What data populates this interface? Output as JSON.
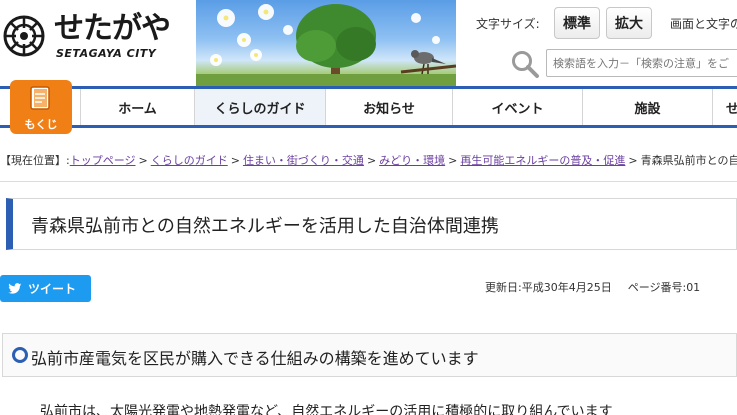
{
  "header": {
    "logo_jp": "せたがや",
    "logo_en": "SETAGAYA CITY",
    "font_size_label": "文字サイズ:",
    "font_size_standard": "標準",
    "font_size_large": "拡大",
    "color_label": "画面と文字の",
    "search_placeholder": "検索語を入力－「検索の注意」をご"
  },
  "nav": {
    "mokuji_label": "もくじ",
    "items": [
      {
        "label": "ホーム"
      },
      {
        "label": "くらしのガイド",
        "active": true
      },
      {
        "label": "お知らせ"
      },
      {
        "label": "イベント"
      },
      {
        "label": "施設"
      },
      {
        "label": "せ"
      }
    ]
  },
  "breadcrumb": {
    "prefix": "【現在位置】:",
    "links": [
      "トップページ",
      "くらしのガイド",
      "住まい・街づくり・交通",
      "みどり・環境",
      "再生可能エネルギーの普及・促進"
    ],
    "current": "青森県弘前市との自然"
  },
  "page": {
    "title": "青森県弘前市との自然エネルギーを活用した自治体間連携",
    "tweet_label": "ツイート",
    "updated": "更新日:平成30年4月25日",
    "page_id": "ページ番号:01",
    "section_heading": "弘前市産電気を区民が購入できる仕組みの構築を進めています",
    "body_start": "弘前市は、太陽光発電や地熱発電など、自然エネルギーの活用に積極的に取り組んでいます"
  },
  "colors": {
    "accent_blue": "#2c5fb3",
    "mokuji_orange": "#f07f16",
    "twitter_blue": "#1d9bf0",
    "link_purple": "#6b3fa0"
  }
}
